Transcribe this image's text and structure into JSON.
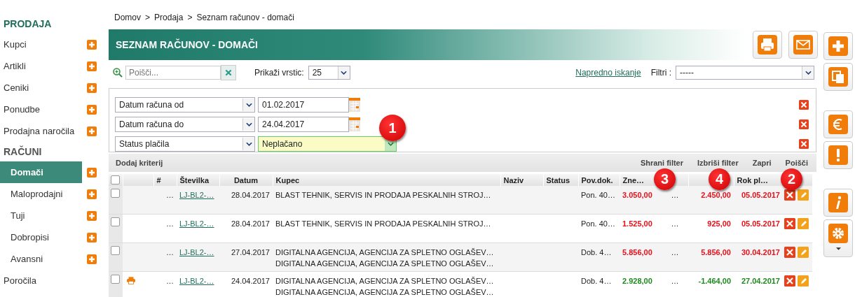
{
  "sidebar": [
    {
      "kind": "heading",
      "label": "PRODAJA",
      "active": true
    },
    {
      "kind": "item",
      "label": "Kupci",
      "selected": false,
      "add": true
    },
    {
      "kind": "item",
      "label": "Artikli",
      "selected": false,
      "add": true
    },
    {
      "kind": "item",
      "label": "Ceniki",
      "selected": false,
      "add": true
    },
    {
      "kind": "item",
      "label": "Ponudbe",
      "selected": false,
      "add": true
    },
    {
      "kind": "item",
      "label": "Prodajna naročila",
      "selected": false,
      "add": true
    },
    {
      "kind": "heading",
      "label": "RAČUNI",
      "active": false
    },
    {
      "kind": "subitem",
      "label": "Domači",
      "selected": true,
      "add": true
    },
    {
      "kind": "subitem",
      "label": "Maloprodajni",
      "selected": false,
      "add": true
    },
    {
      "kind": "subitem",
      "label": "Tuji",
      "selected": false,
      "add": true
    },
    {
      "kind": "subitem",
      "label": "Dobropisi",
      "selected": false,
      "add": true
    },
    {
      "kind": "subitem",
      "label": "Avansni",
      "selected": false,
      "add": true
    },
    {
      "kind": "item",
      "label": "Poročila",
      "selected": false,
      "add": false
    }
  ],
  "breadcrumb": {
    "separator": ">",
    "items": [
      "Domov",
      "Prodaja",
      "Seznam računov - domači"
    ]
  },
  "title": "SEZNAM RAČUNOV - DOMAČI",
  "toolbar": {
    "search_placeholder": "Poišči...",
    "rows_label": "Prikaži vrstic:",
    "rows_value": "25",
    "advanced_link": "Napredno iskanje",
    "filters_label": "Filtri :",
    "filters_value": "-----"
  },
  "filters": [
    {
      "kind": "date",
      "field": "Datum računa od",
      "value": "01.02.2017"
    },
    {
      "kind": "date",
      "field": "Datum računa do",
      "value": "24.04.2017"
    },
    {
      "kind": "select",
      "field": "Status plačila",
      "value": "Neplačano"
    }
  ],
  "filter_actions": {
    "add": "Dodaj kriterij",
    "buttons": [
      "Shrani filter",
      "Izbriši filter",
      "Zapri",
      "Poišči"
    ]
  },
  "table": {
    "select_all_checked": false,
    "columns": [
      "#",
      "Številka",
      "Datum",
      "Kupec",
      "Naziv",
      "Status",
      "Pov.dok.",
      "Zne…",
      "Rok pl…"
    ],
    "rows": [
      {
        "checked": false,
        "printed": false,
        "kind": "overdue",
        "hash": "…",
        "number": "LJ-BL2-…",
        "date": "28.04.2017",
        "customer": [
          "BLAST TEHNIK, SERVIS IN PRODAJA PESKALNIH STROJ…"
        ],
        "ref": "Pon. 40…",
        "amount": "3.050,00",
        "column_11": "…",
        "column_12": "2.450,00",
        "due": "05.05.2017"
      },
      {
        "checked": false,
        "printed": false,
        "kind": "overdue",
        "hash": "…",
        "number": "LJ-BL2-…",
        "date": "28.04.2017",
        "customer": [
          "BLAST TEHNIK, SERVIS IN PRODAJA PESKALNIH STROJ…"
        ],
        "ref": "Pon. 40…",
        "amount": "1.525,00",
        "column_11": "…",
        "column_12": "925,00",
        "due": "05.05.2017"
      },
      {
        "checked": false,
        "printed": false,
        "kind": "overdue",
        "hash": "…",
        "number": "LJ-BL2-…",
        "date": "27.04.2017",
        "customer": [
          "DIGITALNA AGENCIJA, AGENCIJA ZA SPLETNO OGLAŠEV…",
          "DIGITALNA AGENCIJA, AGENCIJA ZA SPLETNO OGLAŠEV…"
        ],
        "ref": "Dob. 4…",
        "amount": "5.856,00",
        "column_11": "…",
        "column_12": "5.856,00",
        "due": "30.04.2017"
      },
      {
        "checked": false,
        "printed": true,
        "kind": "ok",
        "hash": "…",
        "number": "LJ-BL2-…",
        "date": "24.04.2017",
        "customer": [
          "DIGITALNA AGENCIJA, AGENCIJA ZA SPLETNO OGLAŠEV…",
          "DIGITALNA AGENCIJA, AGENCIJA ZA SPLETNO OGLAŠEV…"
        ],
        "ref": "Dob. 4…",
        "amount": "2.928,00",
        "column_11": "…",
        "column_12": "-1.464,00",
        "due": "27.04.2017"
      }
    ]
  },
  "callouts": [
    "1",
    "3",
    "4",
    "2"
  ]
}
